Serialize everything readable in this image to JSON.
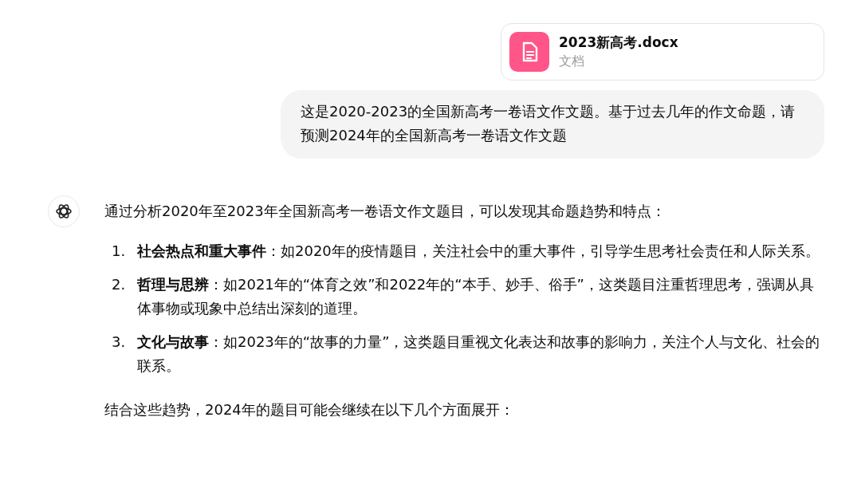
{
  "attachment": {
    "filename": "2023新高考.docx",
    "type_label": "文档"
  },
  "user_message": "这是2020-2023的全国新高考一卷语文作文题。基于过去几年的作文命题，请预测2024年的全国新高考一卷语文作文题",
  "assistant": {
    "intro": "通过分析2020年至2023年全国新高考一卷语文作文题目，可以发现其命题趋势和特点：",
    "items": [
      {
        "number": "1.",
        "text": "**社会热点和重大事件**：如2020年的疫情题目，关注社会中的重大事件，引导学生思考社会责任和人际关系。"
      },
      {
        "number": "2.",
        "text": "**哲理与思辨**：如2021年的“体育之效”和2022年的“本手、妙手、俗手”，这类题目注重哲理思考，强调从具体事物或现象中总结出深刻的道理。"
      },
      {
        "number": "3.",
        "text": "**文化与故事**：如2023年的“故事的力量”，这类题目重视文化表达和故事的影响力，关注个人与文化、社会的联系。"
      }
    ],
    "outro": "结合这些趋势，2024年的题目可能会继续在以下几个方面展开："
  }
}
